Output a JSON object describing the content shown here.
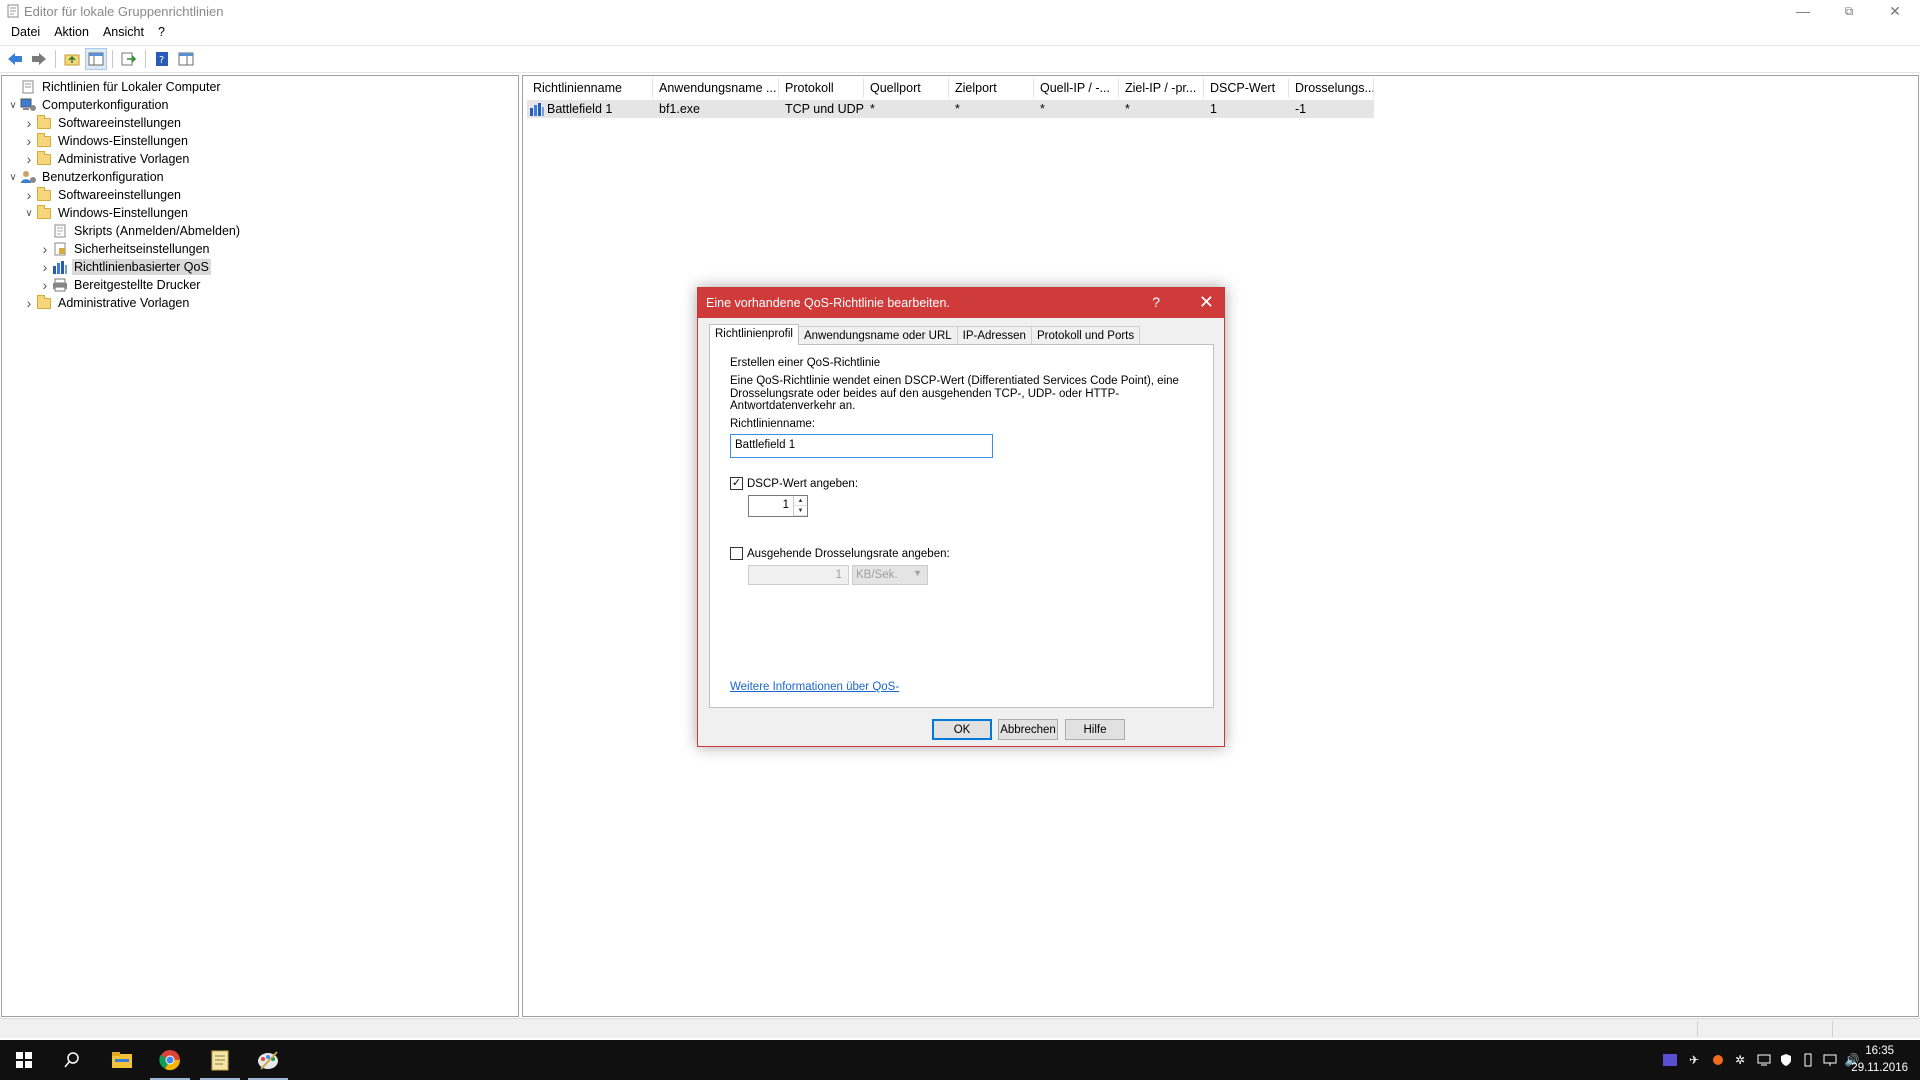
{
  "window": {
    "title": "Editor für lokale Gruppenrichtlinien"
  },
  "menu": [
    "Datei",
    "Aktion",
    "Ansicht",
    "?"
  ],
  "tree": [
    {
      "label": "Richtlinien für Lokaler Computer",
      "level": 0,
      "icon": "policy-icon",
      "expander": ""
    },
    {
      "label": "Computerkonfiguration",
      "level": 0,
      "icon": "computer-icon",
      "expander": "down"
    },
    {
      "label": "Softwareeinstellungen",
      "level": 1,
      "icon": "folder-icon",
      "expander": "right"
    },
    {
      "label": "Windows-Einstellungen",
      "level": 1,
      "icon": "folder-icon",
      "expander": "right"
    },
    {
      "label": "Administrative Vorlagen",
      "level": 1,
      "icon": "folder-icon",
      "expander": "right"
    },
    {
      "label": "Benutzerkonfiguration",
      "level": 0,
      "icon": "user-icon",
      "expander": "down"
    },
    {
      "label": "Softwareeinstellungen",
      "level": 1,
      "icon": "folder-icon",
      "expander": "right"
    },
    {
      "label": "Windows-Einstellungen",
      "level": 1,
      "icon": "folder-icon",
      "expander": "down"
    },
    {
      "label": "Skripts (Anmelden/Abmelden)",
      "level": 2,
      "icon": "script-icon",
      "expander": ""
    },
    {
      "label": "Sicherheitseinstellungen",
      "level": 2,
      "icon": "security-icon",
      "expander": "right"
    },
    {
      "label": "Richtlinienbasierter QoS",
      "level": 2,
      "icon": "qos-icon",
      "expander": "right",
      "selected": true
    },
    {
      "label": "Bereitgestellte Drucker",
      "level": 2,
      "icon": "printer-icon",
      "expander": "right"
    },
    {
      "label": "Administrative Vorlagen",
      "level": 1,
      "icon": "folder-icon",
      "expander": "right"
    }
  ],
  "list": {
    "columns": [
      "Richtlinienname",
      "Anwendungsname ...",
      "Protokoll",
      "Quellport",
      "Zielport",
      "Quell-IP / -...",
      "Ziel-IP / -pr...",
      "DSCP-Wert",
      "Drosselungs..."
    ],
    "rows": [
      [
        "Battlefield 1",
        "bf1.exe",
        "TCP und UDP",
        "*",
        "*",
        "*",
        "*",
        "1",
        "-1"
      ]
    ]
  },
  "dialog": {
    "title": "Eine vorhandene QoS-Richtlinie bearbeiten.",
    "help": "?",
    "tabs": [
      "Richtlinienprofil",
      "Anwendungsname oder URL",
      "IP-Adressen",
      "Protokoll und Ports"
    ],
    "heading": "Erstellen einer QoS-Richtlinie",
    "description_line1": "Eine QoS-Richtlinie wendet einen DSCP-Wert (Differentiated Services Code Point), eine",
    "description_line2": "Drosselungsrate oder beides auf den ausgehenden TCP-, UDP- oder HTTP-Antwortdatenverkehr an.",
    "name_label": "Richtlinienname:",
    "name_value": "Battlefield 1",
    "dscp_checkbox_label": "DSCP-Wert angeben:",
    "dscp_checked": true,
    "dscp_value": "1",
    "throttle_checkbox_label": "Ausgehende Drosselungsrate angeben:",
    "throttle_checked": false,
    "throttle_value": "1",
    "throttle_unit": "KB/Sek.",
    "link": "Weitere Informationen über QoS-",
    "buttons": {
      "ok": "OK",
      "cancel": "Abbrechen",
      "help": "Hilfe"
    }
  },
  "clock": {
    "time": "16:35",
    "date": "29.11.2016"
  },
  "colors": {
    "dialog_title": "#cf3b3b",
    "accent": "#0078d7",
    "taskbar": "#101010"
  }
}
